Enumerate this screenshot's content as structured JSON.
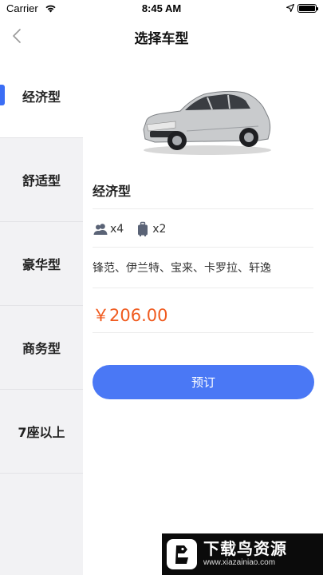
{
  "status_bar": {
    "carrier": "Carrier",
    "time": "8:45 AM"
  },
  "nav": {
    "title": "选择车型"
  },
  "sidebar": {
    "items": [
      {
        "label": "经济型",
        "active": true
      },
      {
        "label": "舒适型",
        "active": false
      },
      {
        "label": "豪华型",
        "active": false
      },
      {
        "label": "商务型",
        "active": false
      },
      {
        "label": "7座以上",
        "active": false
      }
    ]
  },
  "car": {
    "name": "经济型",
    "passengers": "x4",
    "luggage": "x2",
    "models": "锋范、伊兰特、宝来、卡罗拉、轩逸",
    "price": "￥206.00"
  },
  "book_button": {
    "label": "预订"
  },
  "colors": {
    "accent": "#4a78f5",
    "price": "#f05a1e",
    "sidebar_bg": "#f2f2f4"
  },
  "watermark": {
    "title": "下载鸟资源",
    "url": "www.xiazainiao.com"
  }
}
